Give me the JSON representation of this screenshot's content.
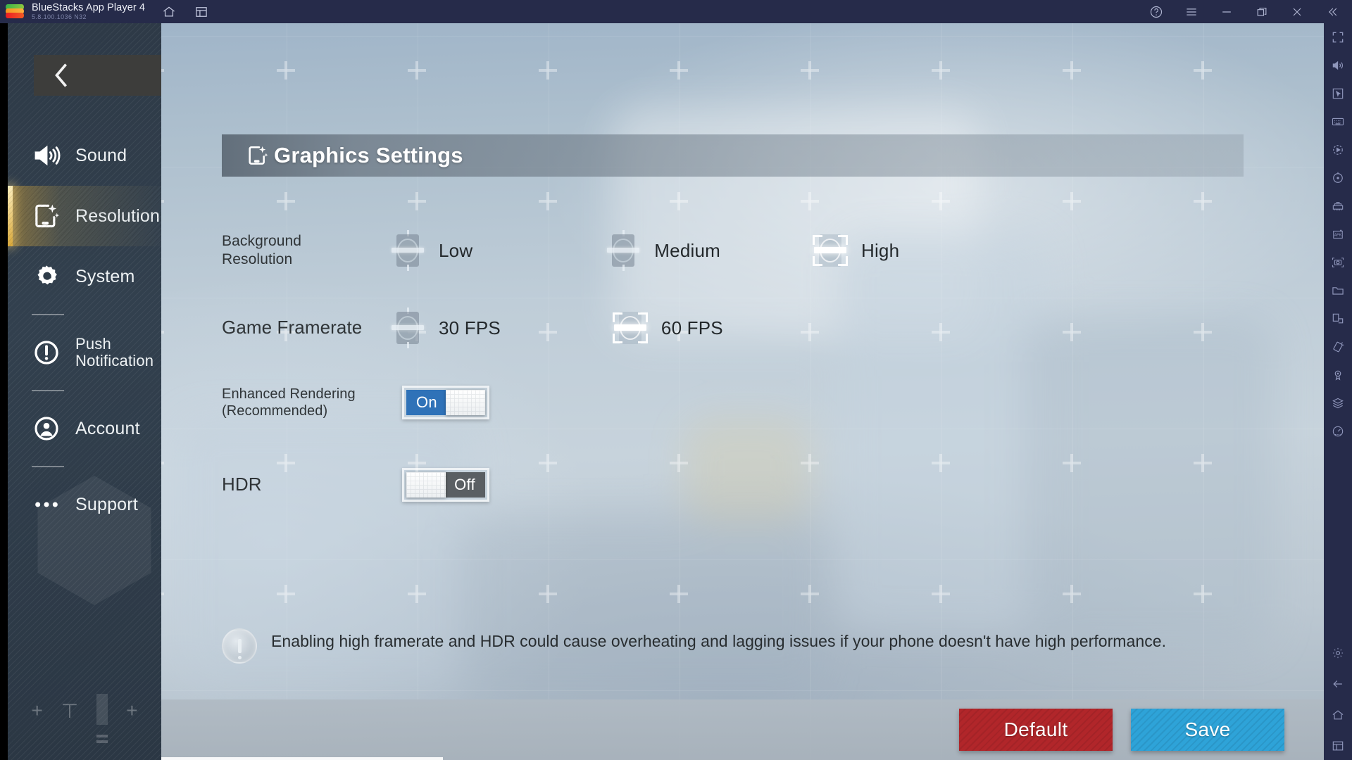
{
  "window": {
    "app_title": "BlueStacks App Player 4",
    "version": "5.8.100.1036  N32",
    "titlebar_icons": [
      "home-icon",
      "multi-instance-icon"
    ],
    "titlebar_right_icons": [
      "help-icon",
      "menu-icon",
      "minimize-icon",
      "restore-icon",
      "close-icon",
      "collapse-icon"
    ]
  },
  "rail": {
    "top_icons": [
      "fullscreen-icon",
      "volume-icon",
      "cursor-icon",
      "keyboard-icon",
      "record-icon",
      "rotate-icon",
      "multi-instance-manager-icon",
      "install-apk-icon",
      "screenshot-icon",
      "folder-icon",
      "screen-rotate-icon",
      "shake-icon",
      "location-icon",
      "macro-icon",
      "gauge-icon"
    ],
    "bottom_icons": [
      "settings-gear-icon",
      "back-icon",
      "home-icon",
      "recents-icon"
    ]
  },
  "game_menu": {
    "back_label": "Back",
    "items": [
      {
        "label": "Sound",
        "icon": "sound-icon",
        "active": false,
        "separator_after": false
      },
      {
        "label": "Resolution",
        "icon": "resolution-icon",
        "active": true,
        "separator_after": false
      },
      {
        "label": "System",
        "icon": "system-gear-icon",
        "active": false,
        "separator_after": true
      },
      {
        "label": "Push\nNotification",
        "icon": "push-notification-icon",
        "active": false,
        "separator_after": true
      },
      {
        "label": "Account",
        "icon": "account-icon",
        "active": false,
        "separator_after": true
      },
      {
        "label": "Support",
        "icon": "support-dots-icon",
        "active": false,
        "separator_after": false
      }
    ]
  },
  "panel": {
    "header": {
      "title": "Graphics Settings",
      "icon": "resolution-icon"
    },
    "settings": [
      {
        "id": "background-resolution",
        "label": "Background Resolution",
        "type": "radio",
        "options": [
          {
            "label": "Low",
            "selected": false
          },
          {
            "label": "Medium",
            "selected": false
          },
          {
            "label": "High",
            "selected": true
          }
        ]
      },
      {
        "id": "game-framerate",
        "label": "Game Framerate",
        "type": "radio",
        "options": [
          {
            "label": "30 FPS",
            "selected": false
          },
          {
            "label": "60 FPS",
            "selected": true
          }
        ]
      },
      {
        "id": "enhanced-rendering",
        "label": "Enhanced Rendering\n(Recommended)",
        "type": "toggle",
        "state": "on",
        "state_label": "On"
      },
      {
        "id": "hdr",
        "label": "HDR",
        "type": "toggle",
        "state": "off",
        "state_label": "Off"
      }
    ],
    "note": {
      "icon": "info-icon",
      "text": "Enabling high framerate and HDR could cause overheating and lagging issues if your phone doesn't have high performance."
    },
    "footer": {
      "default_label": "Default",
      "save_label": "Save"
    }
  },
  "colors": {
    "titlebar": "#262b4a",
    "accent_blue": "#2f72b8",
    "save_button": "#2ea3d8",
    "default_button": "#b1262a",
    "active_item_gold": "#d9a93c",
    "toggle_off": "#5a5f63"
  }
}
